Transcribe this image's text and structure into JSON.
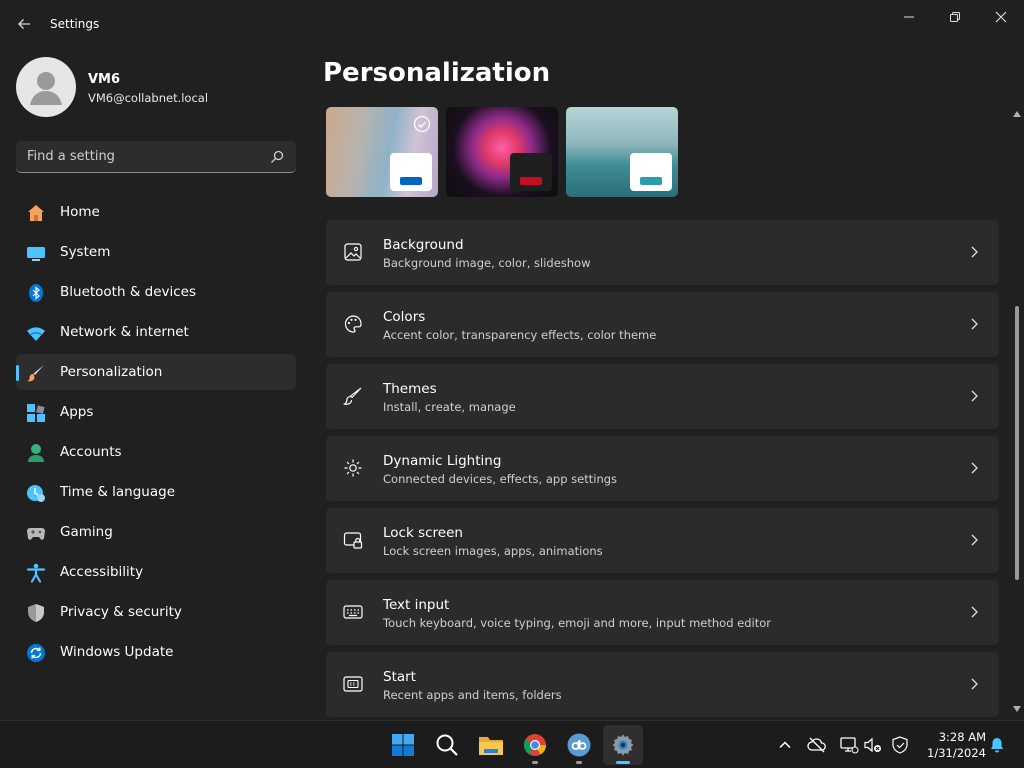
{
  "window": {
    "title": "Settings"
  },
  "profile": {
    "name": "VM6",
    "email": "VM6@collabnet.local"
  },
  "search": {
    "placeholder": "Find a setting"
  },
  "nav": [
    {
      "label": "Home",
      "icon": "home-icon"
    },
    {
      "label": "System",
      "icon": "system-icon"
    },
    {
      "label": "Bluetooth & devices",
      "icon": "bluetooth-icon"
    },
    {
      "label": "Network & internet",
      "icon": "network-icon"
    },
    {
      "label": "Personalization",
      "icon": "brush-icon",
      "active": true
    },
    {
      "label": "Apps",
      "icon": "apps-icon"
    },
    {
      "label": "Accounts",
      "icon": "accounts-icon"
    },
    {
      "label": "Time & language",
      "icon": "time-language-icon"
    },
    {
      "label": "Gaming",
      "icon": "gaming-icon"
    },
    {
      "label": "Accessibility",
      "icon": "accessibility-icon"
    },
    {
      "label": "Privacy & security",
      "icon": "shield-icon"
    },
    {
      "label": "Windows Update",
      "icon": "update-icon"
    }
  ],
  "page": {
    "title": "Personalization"
  },
  "themes": [
    {
      "name": "beach-theme",
      "accent": "#0067c0"
    },
    {
      "name": "bloom-theme",
      "accent": "#c50f1f"
    },
    {
      "name": "lake-theme",
      "accent": "#2d9ea8"
    }
  ],
  "cards": [
    {
      "title": "Background",
      "desc": "Background image, color, slideshow",
      "icon": "image-icon"
    },
    {
      "title": "Colors",
      "desc": "Accent color, transparency effects, color theme",
      "icon": "palette-icon"
    },
    {
      "title": "Themes",
      "desc": "Install, create, manage",
      "icon": "brush-icon"
    },
    {
      "title": "Dynamic Lighting",
      "desc": "Connected devices, effects, app settings",
      "icon": "lighting-icon"
    },
    {
      "title": "Lock screen",
      "desc": "Lock screen images, apps, animations",
      "icon": "lock-screen-icon"
    },
    {
      "title": "Text input",
      "desc": "Touch keyboard, voice typing, emoji and more, input method editor",
      "icon": "keyboard-icon"
    },
    {
      "title": "Start",
      "desc": "Recent apps and items, folders",
      "icon": "start-icon"
    }
  ],
  "taskbar": {
    "apps": [
      "windows-start-icon",
      "search-icon",
      "file-explorer-icon",
      "chrome-icon",
      "qbittorrent-icon",
      "settings-icon"
    ],
    "time": "3:28 AM",
    "date": "1/31/2024"
  },
  "colors": {
    "accent": "#4cc2ff",
    "background": "#202020",
    "card": "#2b2b2b"
  }
}
